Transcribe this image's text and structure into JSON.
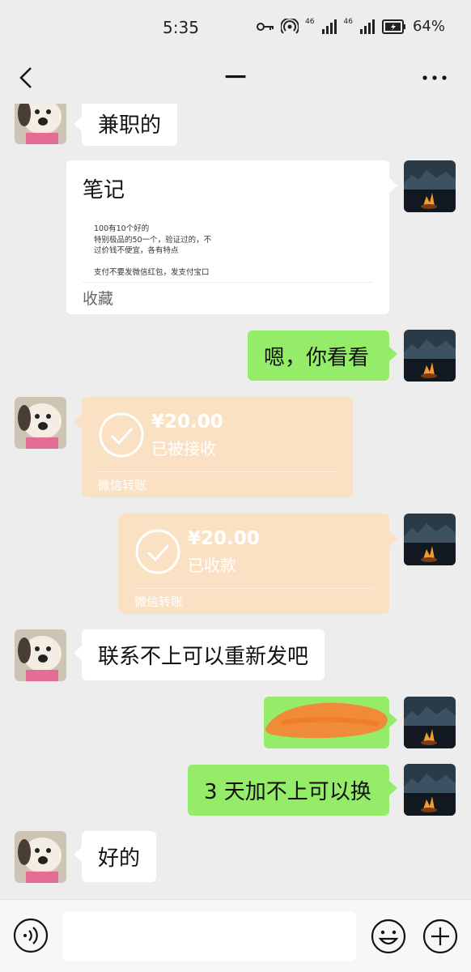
{
  "status_bar": {
    "time": "5:35",
    "network_1": "46",
    "network_2": "46",
    "battery": "64%"
  },
  "header": {
    "title": "一",
    "back_icon": "chevron-left-icon",
    "more_icon": "ellipsis-icon"
  },
  "messages": [
    {
      "side": "left",
      "type": "text",
      "text": "兼职的"
    },
    {
      "side": "right",
      "type": "note",
      "title": "笔记",
      "lines": [
        "100有10个好的",
        "特别极品的50一个，验证过的，不",
        "过价钱不便宜，各有特点",
        "",
        "支付不要发微信红包，发支付宝口"
      ],
      "footer": "收藏"
    },
    {
      "side": "right",
      "type": "text",
      "text": "嗯，你看看"
    },
    {
      "side": "left",
      "type": "transfer",
      "amount": "¥20.00",
      "status": "已被接收",
      "label": "微信转账"
    },
    {
      "side": "right",
      "type": "transfer",
      "amount": "¥20.00",
      "status": "已收款",
      "label": "微信转账"
    },
    {
      "side": "left",
      "type": "text",
      "text": "联系不上可以重新发吧"
    },
    {
      "side": "right",
      "type": "redacted",
      "text": ""
    },
    {
      "side": "right",
      "type": "text",
      "text": "3 天加不上可以换"
    },
    {
      "side": "left",
      "type": "text",
      "text": "好的"
    }
  ],
  "input_bar": {
    "placeholder": "",
    "voice_icon": "voice-icon",
    "emoji_icon": "emoji-icon",
    "plus_icon": "plus-icon"
  },
  "colors": {
    "background": "#ededed",
    "sent_bubble": "#95ec69",
    "received_bubble": "#ffffff",
    "transfer_card": "#fbe1c4",
    "redaction": "#f08b3a"
  }
}
